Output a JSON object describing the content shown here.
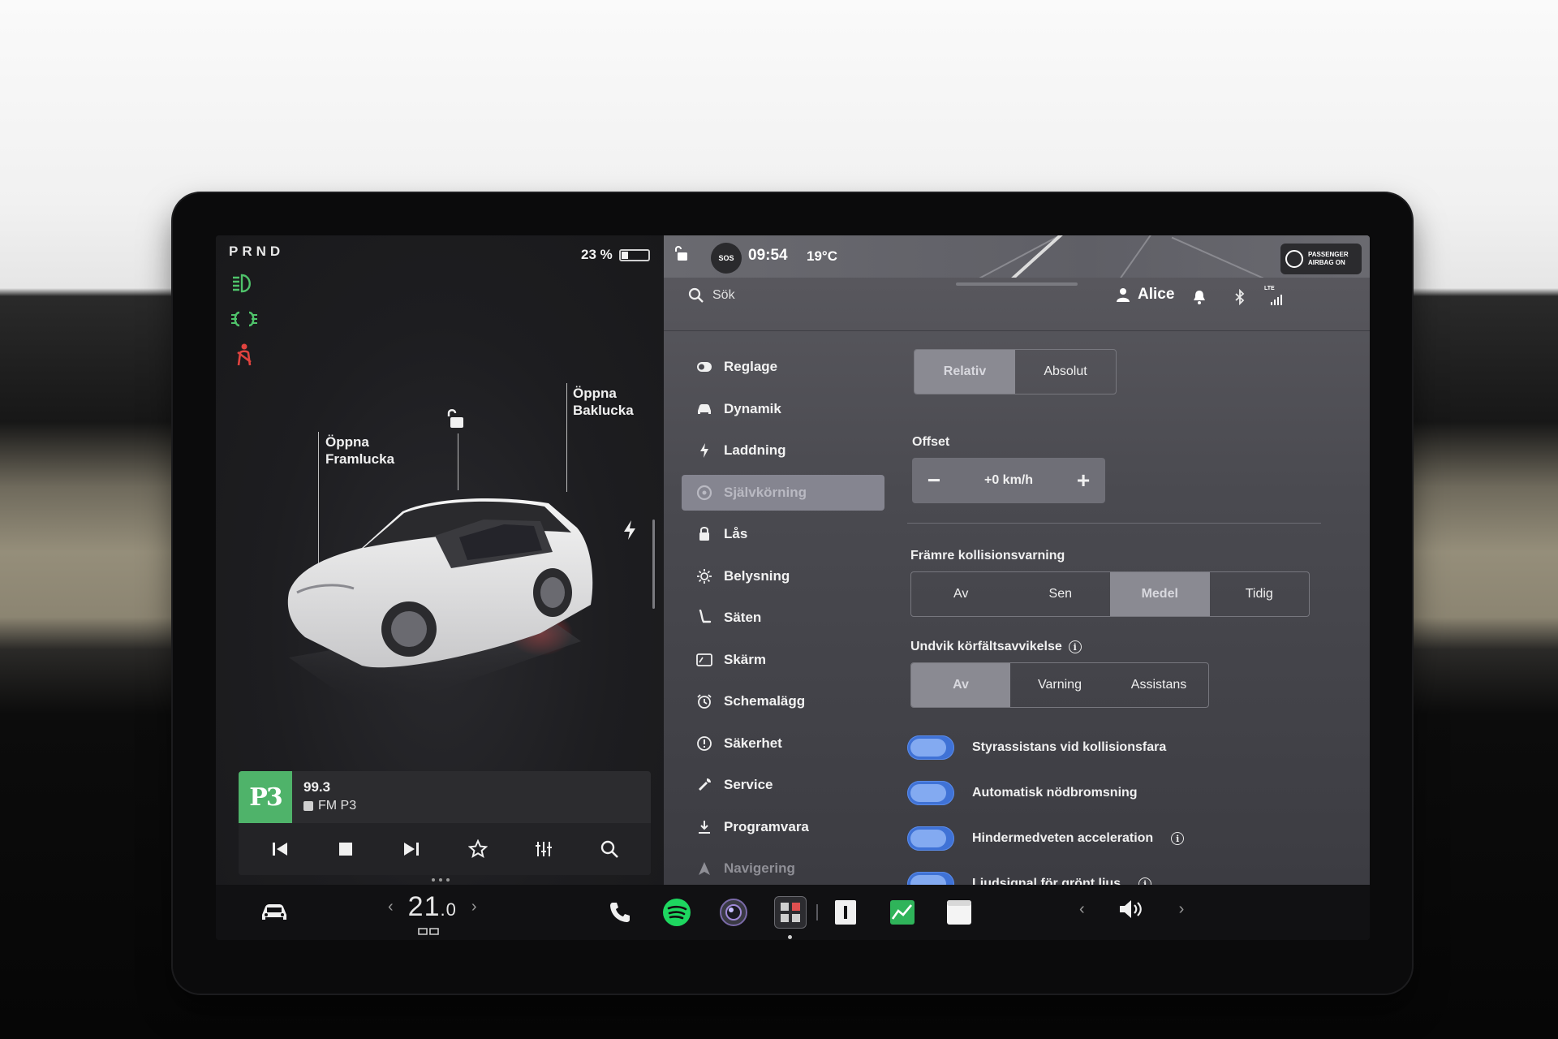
{
  "gear": "PRND",
  "battery": {
    "percent_label": "23 %",
    "level": 0.23
  },
  "callouts": {
    "front_trunk": {
      "line1": "Öppna",
      "line2": "Framlucka"
    },
    "rear_trunk": {
      "line1": "Öppna",
      "line2": "Baklucka"
    }
  },
  "media": {
    "logo": "P3",
    "frequency": "99.3",
    "station": "FM P3"
  },
  "status": {
    "sos": "SOS",
    "time": "09:54",
    "temperature": "19°C",
    "airbag_line1": "PASSENGER",
    "airbag_line2": "AIRBAG ON",
    "lte": "LTE"
  },
  "search": {
    "placeholder": "Sök"
  },
  "user": {
    "name": "Alice"
  },
  "menu": {
    "items": [
      {
        "label": "Reglage",
        "icon": "toggle-icon"
      },
      {
        "label": "Dynamik",
        "icon": "car-icon"
      },
      {
        "label": "Laddning",
        "icon": "bolt-icon"
      },
      {
        "label": "Självkörning",
        "icon": "steering-wheel-icon",
        "active": true
      },
      {
        "label": "Lås",
        "icon": "lock-icon"
      },
      {
        "label": "Belysning",
        "icon": "sun-icon"
      },
      {
        "label": "Säten",
        "icon": "seat-icon"
      },
      {
        "label": "Skärm",
        "icon": "display-icon"
      },
      {
        "label": "Schemalägg",
        "icon": "alarm-clock-icon"
      },
      {
        "label": "Säkerhet",
        "icon": "alert-icon"
      },
      {
        "label": "Service",
        "icon": "wrench-icon"
      },
      {
        "label": "Programvara",
        "icon": "download-icon"
      },
      {
        "label": "Navigering",
        "icon": "navigation-icon"
      }
    ]
  },
  "settings": {
    "speed_mode": {
      "options": [
        "Relativ",
        "Absolut"
      ],
      "selected": "Relativ"
    },
    "offset": {
      "label": "Offset",
      "value": "+0 km/h",
      "minus": "−",
      "plus": "+"
    },
    "collision_warning": {
      "label": "Främre kollisionsvarning",
      "options": [
        "Av",
        "Sen",
        "Medel",
        "Tidig"
      ],
      "selected": "Medel"
    },
    "lane_departure": {
      "label": "Undvik körfältsavvikelse",
      "options": [
        "Av",
        "Varning",
        "Assistans"
      ],
      "selected": "Av"
    },
    "toggles": [
      {
        "label": "Styrassistans vid kollisionsfara",
        "on": true,
        "info": false
      },
      {
        "label": "Automatisk nödbromsning",
        "on": true,
        "info": false
      },
      {
        "label": "Hindermedveten acceleration",
        "on": true,
        "info": true
      },
      {
        "label": "Ljudsignal för grönt ljus",
        "on": true,
        "info": true
      }
    ],
    "info_glyph": "i"
  },
  "dock": {
    "temperature": {
      "whole": "21",
      "decimal": ".0",
      "left_arrow": "‹",
      "right_arrow": "›"
    },
    "volume": {
      "left_arrow": "‹",
      "right_arrow": "›"
    }
  },
  "colors": {
    "accent_green": "#4fb36a",
    "toggle_blue": "#3f72d6",
    "seatbelt_red": "#e0433f",
    "light_green": "#4fc36a"
  }
}
